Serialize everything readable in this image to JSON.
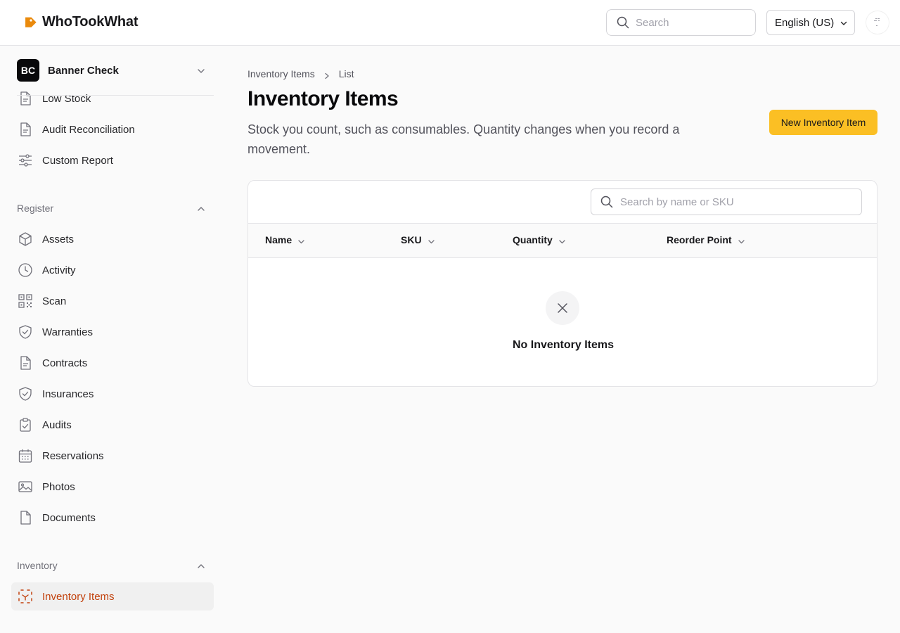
{
  "app": {
    "name": "WhoTookWhat",
    "brand_color": "#ea8a0c"
  },
  "header": {
    "search_placeholder": "Search",
    "language": "English (US)"
  },
  "sidebar": {
    "org": {
      "initials": "BC",
      "name": "Banner Check"
    },
    "report_items": [
      {
        "label": "Low Stock",
        "icon": "document-icon"
      },
      {
        "label": "Audit Reconciliation",
        "icon": "document-icon"
      },
      {
        "label": "Custom Report",
        "icon": "sliders-icon"
      }
    ],
    "register": {
      "title": "Register",
      "items": [
        {
          "label": "Assets",
          "icon": "cube-icon"
        },
        {
          "label": "Activity",
          "icon": "clock-icon"
        },
        {
          "label": "Scan",
          "icon": "qr-code-icon"
        },
        {
          "label": "Warranties",
          "icon": "shield-check-icon"
        },
        {
          "label": "Contracts",
          "icon": "document-icon"
        },
        {
          "label": "Insurances",
          "icon": "shield-check-icon"
        },
        {
          "label": "Audits",
          "icon": "clipboard-check-icon"
        },
        {
          "label": "Reservations",
          "icon": "calendar-icon"
        },
        {
          "label": "Photos",
          "icon": "image-icon"
        },
        {
          "label": "Documents",
          "icon": "file-icon"
        }
      ]
    },
    "inventory": {
      "title": "Inventory",
      "items": [
        {
          "label": "Inventory Items",
          "icon": "inventory-icon",
          "active": true
        }
      ]
    }
  },
  "main": {
    "breadcrumb": [
      "Inventory Items",
      "List"
    ],
    "title": "Inventory Items",
    "subtitle": "Stock you count, such as consumables. Quantity changes when you record a movement.",
    "new_button": "New Inventory Item",
    "accent_color": "#fbbf24",
    "table": {
      "search_placeholder": "Search by name or SKU",
      "columns": [
        "Name",
        "SKU",
        "Quantity",
        "Reorder Point"
      ],
      "rows": [],
      "empty_text": "No Inventory Items"
    }
  }
}
